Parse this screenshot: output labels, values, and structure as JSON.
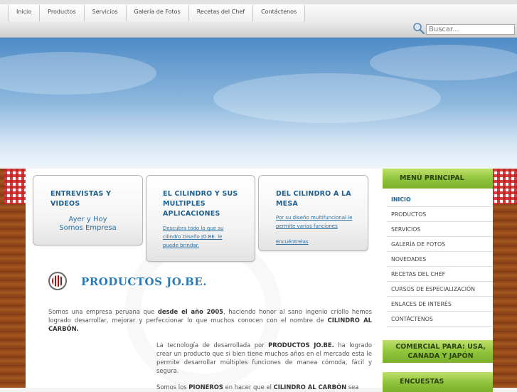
{
  "nav": {
    "items": [
      {
        "label": "Inicio"
      },
      {
        "label": "Productos"
      },
      {
        "label": "Servicios"
      },
      {
        "label": "Galería de Fotos"
      },
      {
        "label": "Recetas del Chef"
      },
      {
        "label": "Contáctenos"
      }
    ]
  },
  "search": {
    "placeholder": "Buscar..."
  },
  "boxes": [
    {
      "title": "ENTREVISTAS Y VIDEOS",
      "links": [
        "Ayer y Hoy",
        "Somos Empresa"
      ]
    },
    {
      "title": "EL CILINDRO Y SUS MULTIPLES APLICACIONES",
      "link": "Descubra todo lo que su cilindro Diseño JO.BE. le puede brindar."
    },
    {
      "title": "DEL CILINDRO A LA MESA",
      "link": "Por su diseño multifuncional le permite varias funciones",
      "link2": ".",
      "link3": "Encuéntrelas"
    }
  ],
  "content": {
    "title": "PRODUCTOS JO.BE.",
    "p1": {
      "a": "Somos una empresa peruana que ",
      "b": "desde el año 2005",
      "c": ", haciendo honor al sano ingenio criollo hemos logrado desarrollar, mejorar y perfeccionar lo que muchos conocen con el nombre de ",
      "d": "CILINDRO AL CARBÓN."
    },
    "p2": {
      "a": "La tecnología de desarrollada por ",
      "b": "PRODUCTOS JO.BE.",
      "c": " ha logrado crear un producto que si bien tiene muchos años en el mercado esta le permite desarrollar múltiples funciones de manea cómoda, fácil y segura."
    },
    "p3": {
      "a": "Somos los ",
      "b": "PIONEROS",
      "c": " en hacer que el ",
      "d": "CILINDRO AL CARBÓN",
      "e": " sea"
    }
  },
  "sidebar": {
    "menu_title": "MENÚ PRINCIPAL",
    "items": [
      {
        "label": "Inicio",
        "active": true
      },
      {
        "label": "Productos"
      },
      {
        "label": "Servicios"
      },
      {
        "label": "Galería de Fotos"
      },
      {
        "label": "Novedades"
      },
      {
        "label": "Recetas del Chef"
      },
      {
        "label": "Cursos de Especialización"
      },
      {
        "label": "Enlaces de Interés"
      },
      {
        "label": "Contáctenos"
      }
    ],
    "commercial_title": "COMERCIAL PARA:   USA, CANADA Y JAPÓN",
    "polls_title": "ENCUESTAS"
  },
  "colors": {
    "accent": "#2b7ab5",
    "sidebar_green": "#8fc23a",
    "active_item": "#1d5f8f"
  }
}
